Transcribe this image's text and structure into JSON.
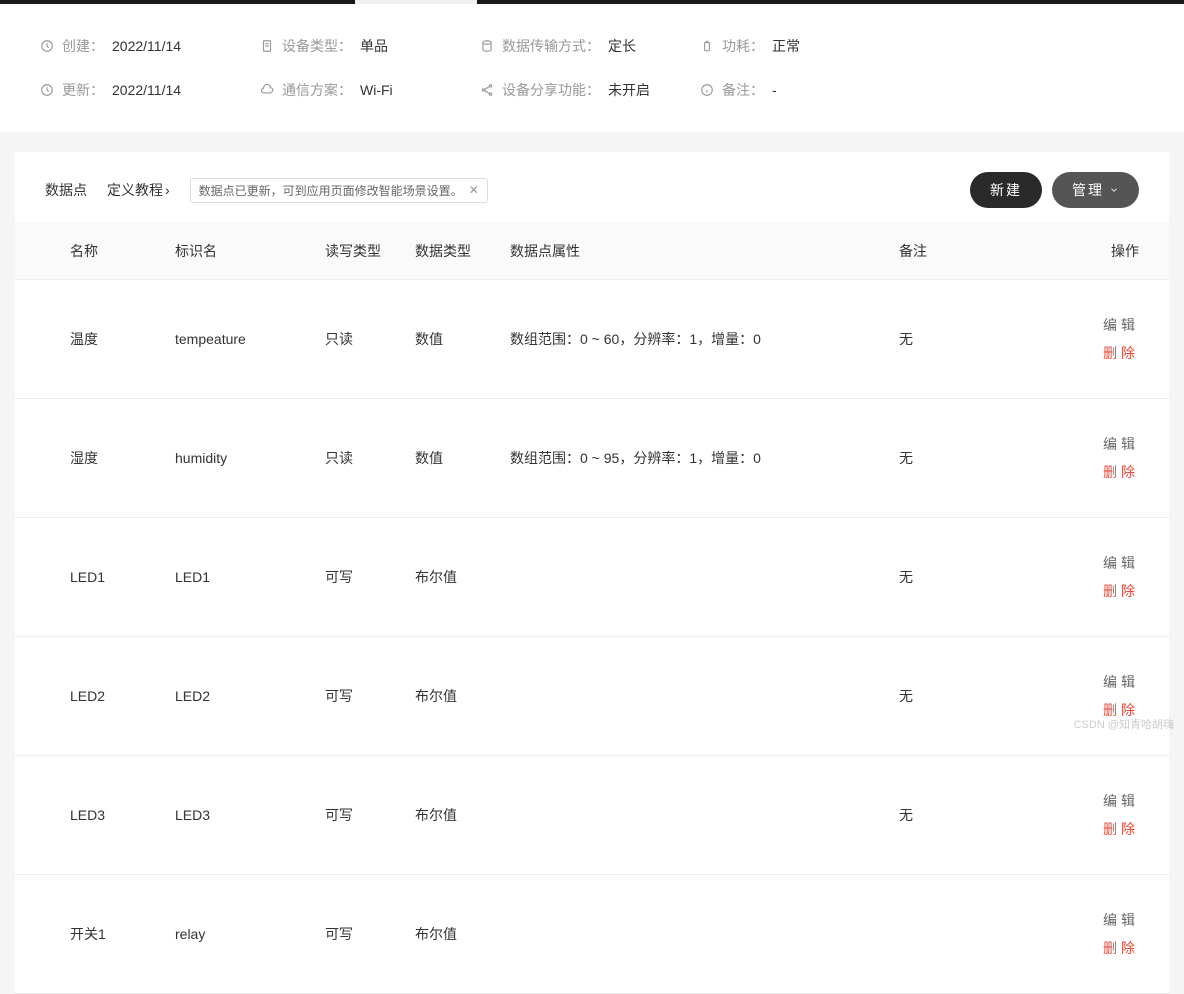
{
  "info": {
    "created": {
      "label": "创建：",
      "value": "2022/11/14"
    },
    "updated": {
      "label": "更新：",
      "value": "2022/11/14"
    },
    "deviceType": {
      "label": "设备类型：",
      "value": "单品"
    },
    "commScheme": {
      "label": "通信方案：",
      "value": "Wi-Fi"
    },
    "transferMode": {
      "label": "数据传输方式：",
      "value": "定长"
    },
    "shareFeature": {
      "label": "设备分享功能：",
      "value": "未开启"
    },
    "power": {
      "label": "功耗：",
      "value": "正常"
    },
    "remark": {
      "label": "备注：",
      "value": "-"
    }
  },
  "toolbar": {
    "sectionTitle": "数据点",
    "tutorialLink": "定义教程",
    "notice": "数据点已更新，可到应用页面修改智能场景设置。",
    "newButton": "新建",
    "manageButton": "管理"
  },
  "headers": {
    "name": "名称",
    "identifier": "标识名",
    "rwType": "读写类型",
    "dataType": "数据类型",
    "attrs": "数据点属性",
    "remark": "备注",
    "actions": "操作"
  },
  "actions": {
    "edit": "编辑",
    "delete": "删除"
  },
  "rows": [
    {
      "name": "温度",
      "identifier": "tempeature",
      "rwType": "只读",
      "dataType": "数值",
      "attrs": "数组范围：0 ~ 60，分辨率：1，增量：0",
      "remark": "无"
    },
    {
      "name": "湿度",
      "identifier": "humidity",
      "rwType": "只读",
      "dataType": "数值",
      "attrs": "数组范围：0 ~ 95，分辨率：1，增量：0",
      "remark": "无"
    },
    {
      "name": "LED1",
      "identifier": "LED1",
      "rwType": "可写",
      "dataType": "布尔值",
      "attrs": "",
      "remark": "无"
    },
    {
      "name": "LED2",
      "identifier": "LED2",
      "rwType": "可写",
      "dataType": "布尔值",
      "attrs": "",
      "remark": "无"
    },
    {
      "name": "LED3",
      "identifier": "LED3",
      "rwType": "可写",
      "dataType": "布尔值",
      "attrs": "",
      "remark": "无"
    },
    {
      "name": "开关1",
      "identifier": "relay",
      "rwType": "可写",
      "dataType": "布尔值",
      "attrs": "",
      "remark": ""
    }
  ],
  "watermark": "CSDN @知青哈胡嗨"
}
